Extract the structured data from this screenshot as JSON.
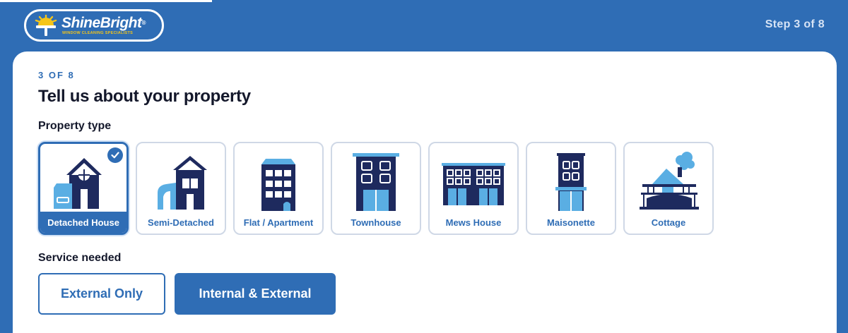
{
  "brand": {
    "name": "ShineBright",
    "registered": "®",
    "tagline": "WINDOW CLEANING SPECIALISTS",
    "colors": {
      "primary": "#2f6db5",
      "navy": "#1e2a5e",
      "light_blue": "#5aaee3",
      "accent": "#f5c518"
    }
  },
  "header": {
    "step_text": "Step 3 of 8"
  },
  "form": {
    "step_kicker": "3 OF 8",
    "title": "Tell us about your property",
    "property_label": "Property type",
    "property_types": [
      {
        "label": "Detached House",
        "icon": "detached-house-icon",
        "selected": true
      },
      {
        "label": "Semi-Detached",
        "icon": "semi-detached-icon",
        "selected": false
      },
      {
        "label": "Flat / Apartment",
        "icon": "flat-apartment-icon",
        "selected": false
      },
      {
        "label": "Townhouse",
        "icon": "townhouse-icon",
        "selected": false
      },
      {
        "label": "Mews House",
        "icon": "mews-house-icon",
        "selected": false
      },
      {
        "label": "Maisonette",
        "icon": "maisonette-icon",
        "selected": false
      },
      {
        "label": "Cottage",
        "icon": "cottage-icon",
        "selected": false
      }
    ],
    "service_label": "Service needed",
    "service_options": [
      {
        "label": "External Only",
        "selected": false
      },
      {
        "label": "Internal & External",
        "selected": true
      }
    ]
  }
}
